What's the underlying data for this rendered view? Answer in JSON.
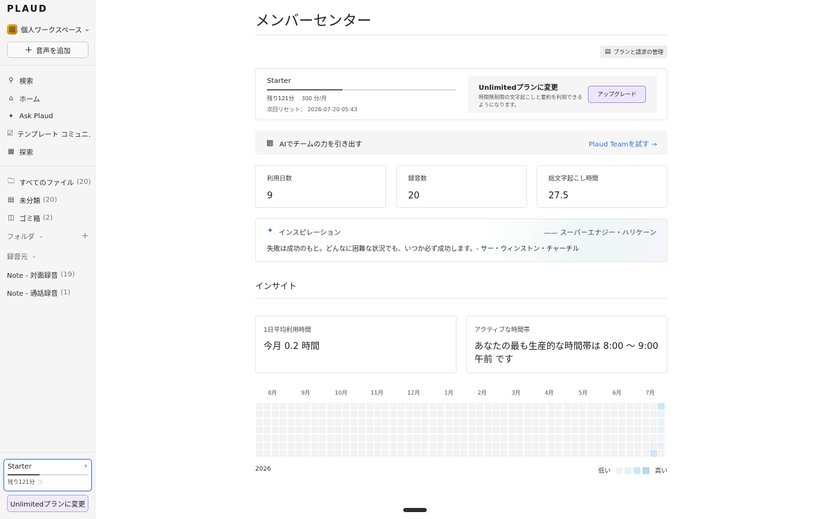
{
  "sidebar": {
    "logo": "PLAUD",
    "workspace": "個人ワークスペース",
    "add_audio": "音声を追加",
    "nav": [
      {
        "label": "検索",
        "icon": "search-icon"
      },
      {
        "label": "ホーム",
        "icon": "home-icon"
      },
      {
        "label": "Ask Plaud",
        "icon": "sparkle-icon"
      },
      {
        "label": "テンプレート コミュニ…",
        "icon": "template-icon"
      },
      {
        "label": "探索",
        "icon": "grid-icon"
      }
    ],
    "files": [
      {
        "label": "すべてのファイル",
        "count": "(20)",
        "icon": "folder-icon"
      },
      {
        "label": "未分類",
        "count": "(20)",
        "icon": "inbox-icon"
      },
      {
        "label": "ゴミ箱",
        "count": "(2)",
        "icon": "trash-icon"
      }
    ],
    "folders_label": "フォルダ",
    "sources_label": "録音元",
    "sources": [
      {
        "label": "Note - 対面録音",
        "count": "(19)"
      },
      {
        "label": "Note - 通話録音",
        "count": "(1)"
      }
    ],
    "plan_card": {
      "title": "Starter",
      "remaining": "残り121分",
      "usage_fraction": 0.4
    },
    "upgrade_button": "Unlimitedプランに変更"
  },
  "main": {
    "title": "メンバーセンター",
    "manage_button": "プランと請求の管理",
    "plan": {
      "name": "Starter",
      "remaining": "残り121分",
      "total": "300 分/月",
      "usage_fraction": 0.4,
      "reset": "次回リセット： 2026-07-20 05:43"
    },
    "upsell": {
      "title": "Unlimitedプランに変更",
      "desc": "時間無制限の文字起こしと要約を利用できるようになります。",
      "button": "アップグレード"
    },
    "team_banner": {
      "text": "AIでチームの力を引き出す",
      "link": "Plaud Teamを試す →"
    },
    "stats": [
      {
        "label": "利用日数",
        "value": "9"
      },
      {
        "label": "録音数",
        "value": "20"
      },
      {
        "label": "総文字起こし時間",
        "value": "27.5"
      }
    ],
    "inspiration": {
      "title": "インスピレーション",
      "author": "—— スーパーエナジー・ハリケーン",
      "quote": "失敗は成功のもと。どんなに困難な状況でも、いつか必ず成功します。- サー・ウィンストン・チャーチル"
    },
    "insight_title": "インサイト",
    "insight_cards": [
      {
        "label": "1日平均利用時間",
        "value": "今月 0.2 時間"
      },
      {
        "label": "アクティブな時間帯",
        "value": "あなたの最も生産的な時間帯は 8:00 〜 9:00 午前 です"
      }
    ],
    "heatmap": {
      "months": [
        "8月",
        "9月",
        "10月",
        "11月",
        "12月",
        "1月",
        "2月",
        "3月",
        "4月",
        "5月",
        "6月",
        "7月"
      ],
      "year": "2026",
      "legend_low": "低い",
      "legend_high": "高い",
      "colors": {
        "empty": "#f3f3f3",
        "low": "#e6f2fa",
        "mid": "#cfe6f4",
        "high": "#b5d8ee"
      },
      "active": [
        {
          "week": 51,
          "day": 0,
          "level": 2
        },
        {
          "week": 51,
          "day": 1,
          "level": 1
        },
        {
          "week": 51,
          "day": 2,
          "level": 1
        },
        {
          "week": 52,
          "day": 2,
          "level": 1
        },
        {
          "week": 51,
          "day": 3,
          "level": 1
        },
        {
          "week": 52,
          "day": 3,
          "level": 1
        },
        {
          "week": 50,
          "day": 5,
          "level": 1
        },
        {
          "week": 51,
          "day": 5,
          "level": 1
        },
        {
          "week": 50,
          "day": 6,
          "level": 2
        }
      ]
    }
  }
}
